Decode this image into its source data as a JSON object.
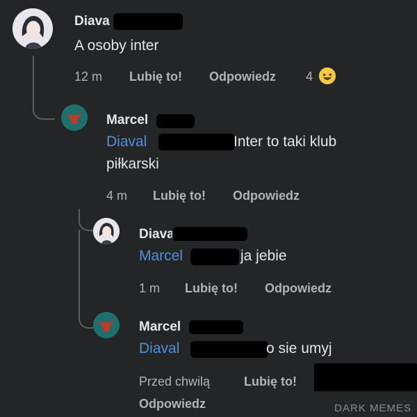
{
  "comments": [
    {
      "author": "Diava",
      "text": "A osoby inter",
      "time": "12 m",
      "like_label": "Lubię to!",
      "reply_label": "Odpowiedz",
      "reaction_count": "4"
    },
    {
      "author": "Marcel",
      "mention": "Diaval",
      "text_line1": "Inter to taki klub",
      "text_line2": "piłkarski",
      "time": "4 m",
      "like_label": "Lubię to!",
      "reply_label": "Odpowiedz"
    },
    {
      "author": "Diava",
      "mention": "Marcel",
      "text": "ja jebie",
      "time": "1 m",
      "like_label": "Lubię to!",
      "reply_label": "Odpowiedz"
    },
    {
      "author": "Marcel",
      "mention": "Diaval",
      "text": "o sie umyj",
      "time": "Przed chwilą",
      "like_label": "Lubię to!",
      "reply_label": "Odpowiedz"
    }
  ],
  "watermark": "DARK MEMES"
}
